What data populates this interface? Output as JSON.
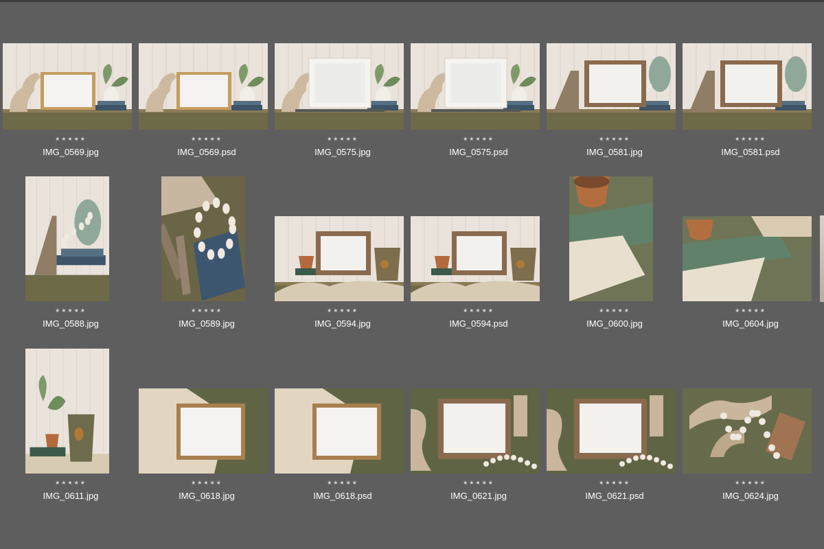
{
  "rating_stars": "★★★★★",
  "files": [
    {
      "name": "IMG_0569.jpg",
      "scene": "wall-white-frame-plant"
    },
    {
      "name": "IMG_0569.psd",
      "scene": "wall-white-frame-plant"
    },
    {
      "name": "IMG_0575.jpg",
      "scene": "wall-white-frame-white-plant"
    },
    {
      "name": "IMG_0575.psd",
      "scene": "wall-white-frame-white-plant"
    },
    {
      "name": "IMG_0581.jpg",
      "scene": "wall-wood-frame-vase-beads"
    },
    {
      "name": "IMG_0581.psd",
      "scene": "wall-wood-frame-vase-beads"
    },
    {
      "name": "IMG_0588.jpg",
      "scene": "portrait-vase-beads-books"
    },
    {
      "name": "IMG_0589.jpg",
      "scene": "portrait-books-beads-spindles"
    },
    {
      "name": "IMG_0594.jpg",
      "scene": "wall-wood-frame-pot-bucket"
    },
    {
      "name": "IMG_0594.psd",
      "scene": "wall-wood-frame-pot-bucket"
    },
    {
      "name": "IMG_0600.jpg",
      "scene": "portrait-pot-green-book-cloth"
    },
    {
      "name": "IMG_0604.jpg",
      "scene": "landscape-pot-green-book-cloth"
    },
    {
      "name": "IMG_0611.jpg",
      "scene": "portrait-plant-pot-bucket"
    },
    {
      "name": "IMG_0618.jpg",
      "scene": "flatlay-frame-cloth"
    },
    {
      "name": "IMG_0618.psd",
      "scene": "flatlay-frame-cloth"
    },
    {
      "name": "IMG_0621.jpg",
      "scene": "flatlay-frame-corbels-beads"
    },
    {
      "name": "IMG_0621.psd",
      "scene": "flatlay-frame-corbels-beads"
    },
    {
      "name": "IMG_0624.jpg",
      "scene": "flatlay-corbels-beads"
    }
  ],
  "colors": {
    "background": "#5e5e5e",
    "filename": "#ffffff",
    "stars": "#d6d6d6"
  }
}
